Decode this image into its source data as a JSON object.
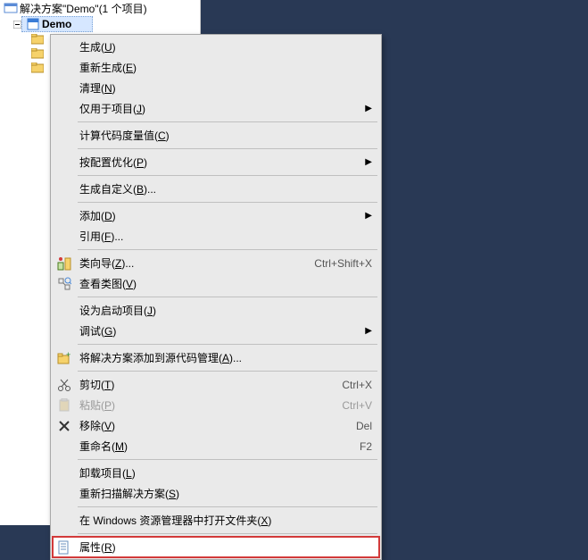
{
  "solution": {
    "title_prefix": "解决方案",
    "name": "Demo",
    "count_label": "(1 个项目)",
    "project_name": "Demo"
  },
  "menu": {
    "build": {
      "label": "生成(",
      "accel": "U",
      "tail": ")"
    },
    "rebuild": {
      "label": "重新生成(",
      "accel": "E",
      "tail": ")"
    },
    "clean": {
      "label": "清理(",
      "accel": "N",
      "tail": ")"
    },
    "project_only": {
      "label": "仅用于项目(",
      "accel": "J",
      "tail": ")"
    },
    "code_metrics": {
      "label": "计算代码度量值(",
      "accel": "C",
      "tail": ")"
    },
    "pgo": {
      "label": "按配置优化(",
      "accel": "P",
      "tail": ")"
    },
    "build_custom": {
      "label": "生成自定义(",
      "accel": "B",
      "tail": ")..."
    },
    "add": {
      "label": "添加(",
      "accel": "D",
      "tail": ")"
    },
    "reference": {
      "label": "引用(",
      "accel": "F",
      "tail": ")..."
    },
    "class_wizard": {
      "label": "类向导(",
      "accel": "Z",
      "tail": ")...",
      "shortcut": "Ctrl+Shift+X"
    },
    "class_diagram": {
      "label": "查看类图(",
      "accel": "V",
      "tail": ")"
    },
    "set_startup": {
      "label": "设为启动项目(",
      "accel": "J",
      "tail": ")"
    },
    "debug": {
      "label": "调试(",
      "accel": "G",
      "tail": ")"
    },
    "add_scc": {
      "label": "将解决方案添加到源代码管理(",
      "accel": "A",
      "tail": ")..."
    },
    "cut": {
      "label": "剪切(",
      "accel": "T",
      "tail": ")",
      "shortcut": "Ctrl+X"
    },
    "paste": {
      "label": "粘贴(",
      "accel": "P",
      "tail": ")",
      "shortcut": "Ctrl+V"
    },
    "remove": {
      "label": "移除(",
      "accel": "V",
      "tail": ")",
      "shortcut": "Del"
    },
    "rename": {
      "label": "重命名(",
      "accel": "M",
      "tail": ")",
      "shortcut": "F2"
    },
    "unload": {
      "label": "卸载项目(",
      "accel": "L",
      "tail": ")"
    },
    "rescan": {
      "label": "重新扫描解决方案(",
      "accel": "S",
      "tail": ")"
    },
    "open_explorer": {
      "label": "在 Windows 资源管理器中打开文件夹(",
      "accel": "X",
      "tail": ")"
    },
    "properties": {
      "label": "属性(",
      "accel": "R",
      "tail": ")"
    }
  },
  "icons": {
    "solution": "solution-icon",
    "project": "project-icon",
    "cpp": "cpp-icon",
    "header": "header-icon",
    "folder": "folder-icon",
    "wizard": "wizard-icon",
    "class_diagram": "class-diagram-icon",
    "scc": "scc-icon",
    "cut": "cut-icon",
    "paste": "paste-icon",
    "remove": "remove-icon",
    "properties": "properties-icon"
  }
}
